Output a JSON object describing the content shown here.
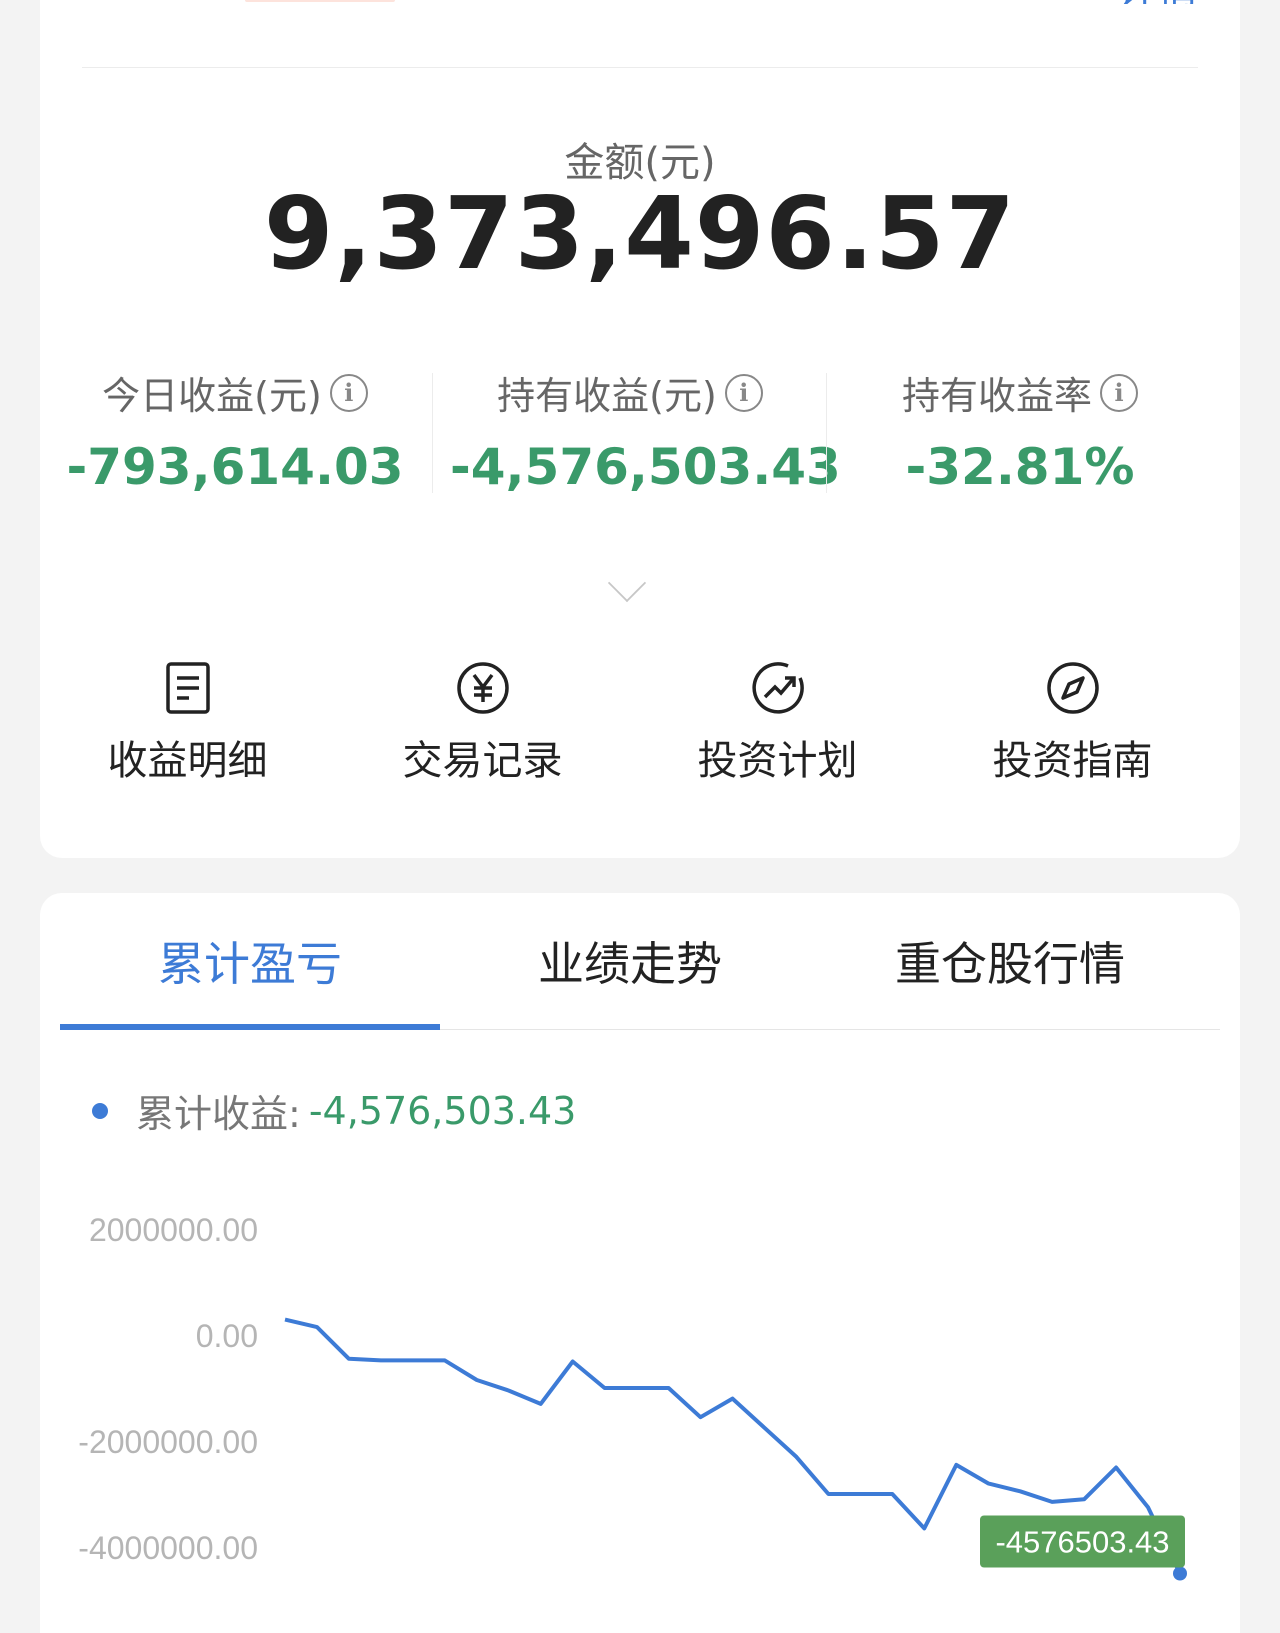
{
  "summary": {
    "amount_label": "金额(元)",
    "amount_value": "9,373,496.57",
    "stats": [
      {
        "label": "今日收益(元)",
        "value": "-793,614.03"
      },
      {
        "label": "持有收益(元)",
        "value": "-4,576,503.43"
      },
      {
        "label": "持有收益率",
        "value": "-32.81%"
      }
    ],
    "actions": [
      {
        "label": "收益明细",
        "icon": "document-icon"
      },
      {
        "label": "交易记录",
        "icon": "yuan-circle-icon"
      },
      {
        "label": "投资计划",
        "icon": "trend-up-icon"
      },
      {
        "label": "投资指南",
        "icon": "compass-icon"
      }
    ]
  },
  "tabs": {
    "items": [
      {
        "label": "累计盈亏",
        "active": true
      },
      {
        "label": "业绩走势",
        "active": false
      },
      {
        "label": "重仓股行情",
        "active": false
      }
    ]
  },
  "legend": {
    "label": "累计收益:",
    "value": "-4,576,503.43"
  },
  "colors": {
    "accent": "#3d7bd6",
    "gain_loss": "#3a9a6a",
    "tooltip_bg": "#5aa05a"
  },
  "chart_data": {
    "type": "line",
    "y_ticks": [
      "2000000.00",
      "0.00",
      "-2000000.00",
      "-4000000.00"
    ],
    "ylim": [
      -4000000,
      2000000
    ],
    "grid": false,
    "tooltip": "-4576503.43",
    "series": [
      {
        "values": [
          290000,
          150000,
          -450000,
          -480000,
          -480000,
          -480000,
          -850000,
          -1050000,
          -1300000,
          -500000,
          -1000000,
          -1000000,
          -1000000,
          -1550000,
          -1200000,
          -1750000,
          -2300000,
          -3000000,
          -3000000,
          -3000000,
          -3650000,
          -2450000,
          -2800000,
          -2950000,
          -3150000,
          -3100000,
          -2500000,
          -3250000,
          -4500000
        ]
      }
    ]
  }
}
